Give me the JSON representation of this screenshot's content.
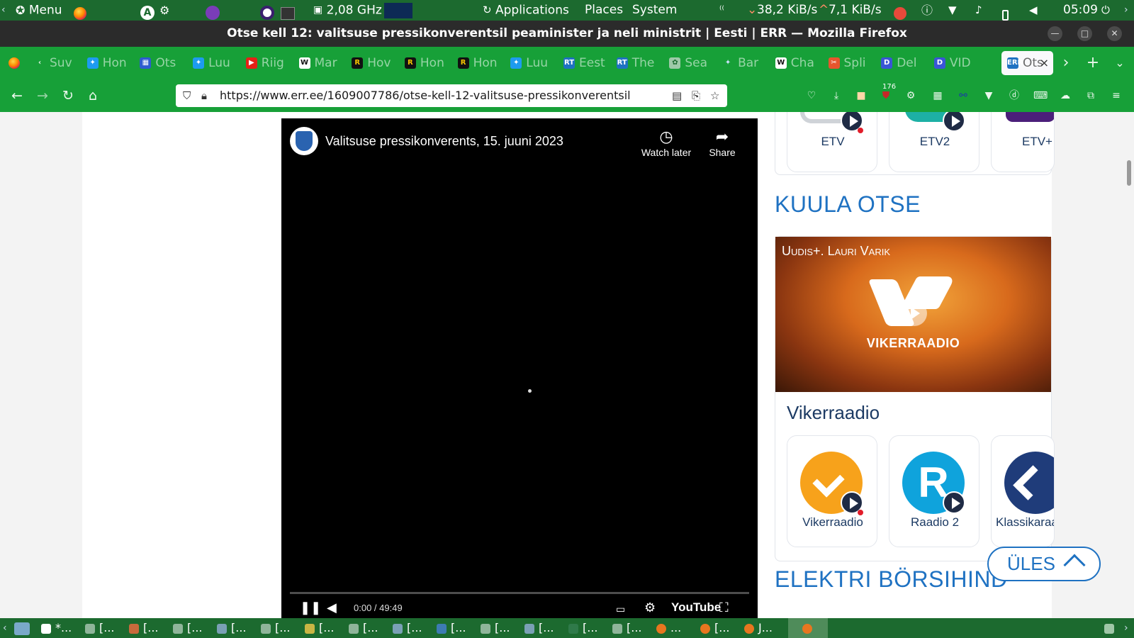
{
  "system_panel": {
    "menu_label": "Menu",
    "cpu_freq": "2,08 GHz",
    "applications_label": "Applications",
    "places_label": "Places",
    "system_label": "System",
    "net_down": "38,2 KiB/s",
    "net_up": "7,1 KiB/s",
    "clock": "05:09"
  },
  "window": {
    "title": "Otse kell 12: valitsuse pressikonverentsil peaminister ja neli ministrit | Eesti | ERR — Mozilla Firefox"
  },
  "tabs": [
    {
      "label": "Suv",
      "favicon": "chevron-icon"
    },
    {
      "label": "Hon",
      "favicon": "twitter-icon"
    },
    {
      "label": "Ots",
      "favicon": "grid-icon"
    },
    {
      "label": "Luu",
      "favicon": "twitter-icon"
    },
    {
      "label": "Riig",
      "favicon": "youtube-icon"
    },
    {
      "label": "Mar",
      "favicon": "wikipedia-icon"
    },
    {
      "label": "Hov",
      "favicon": "r-icon"
    },
    {
      "label": "Hon",
      "favicon": "r-icon"
    },
    {
      "label": "Hon",
      "favicon": "r-icon"
    },
    {
      "label": "Luu",
      "favicon": "twitter-icon"
    },
    {
      "label": "Eest",
      "favicon": "rt-icon"
    },
    {
      "label": "The",
      "favicon": "rt-icon"
    },
    {
      "label": "Sea",
      "favicon": "openai-icon"
    },
    {
      "label": "Bar",
      "favicon": "bard-icon"
    },
    {
      "label": "Cha",
      "favicon": "wikipedia-icon"
    },
    {
      "label": "Spli",
      "favicon": "split-icon"
    },
    {
      "label": "Del",
      "favicon": "d-icon"
    },
    {
      "label": "VID",
      "favicon": "d-icon"
    }
  ],
  "active_tab": {
    "label": "Ots",
    "close": "×"
  },
  "navbar": {
    "url": "https://www.err.ee/1609007786/otse-kell-12-valitsuse-pressikonverentsil",
    "badge_count": "176"
  },
  "video": {
    "title": "Valitsuse pressikonverents, 15. juuni 2023",
    "watch_later": "Watch later",
    "share": "Share",
    "time": "0:00 / 49:49",
    "youtube_label": "YouTube"
  },
  "tv_channels": [
    {
      "label": "ETV"
    },
    {
      "label": "ETV2"
    },
    {
      "label": "ETV+"
    }
  ],
  "listen_live": {
    "heading": "KUULA OTSE",
    "banner_show": "Uudis+. Lauri Varik",
    "banner_logo_text": "VIKERRAADIO",
    "station_name": "Vikerraadio",
    "stations": [
      {
        "label": "Vikerraadio"
      },
      {
        "label": "Raadio 2"
      },
      {
        "label": "Klassikaraadio"
      }
    ]
  },
  "electricity": {
    "heading": "ELEKTRI BÖRSIHIND"
  },
  "back_to_top": {
    "label": "ÜLES"
  },
  "colors": {
    "panel": "#1c6a2f",
    "toolbar": "#17a038",
    "accent_blue": "#1f72c2",
    "etv_purple": "#4b1f7a",
    "vikerraadio_orange": "#f7a21b",
    "raadio2_cyan": "#0fa3dc",
    "klassika_navy": "#1f3c7a"
  },
  "taskbar": {
    "items": [
      "*...",
      "[...",
      "[...",
      "[...",
      "[...",
      "[...",
      "[...",
      "[...",
      "[...",
      "[...",
      "[...",
      "[...",
      "[...",
      "[...",
      "...",
      "[...",
      "J...",
      ""
    ]
  }
}
